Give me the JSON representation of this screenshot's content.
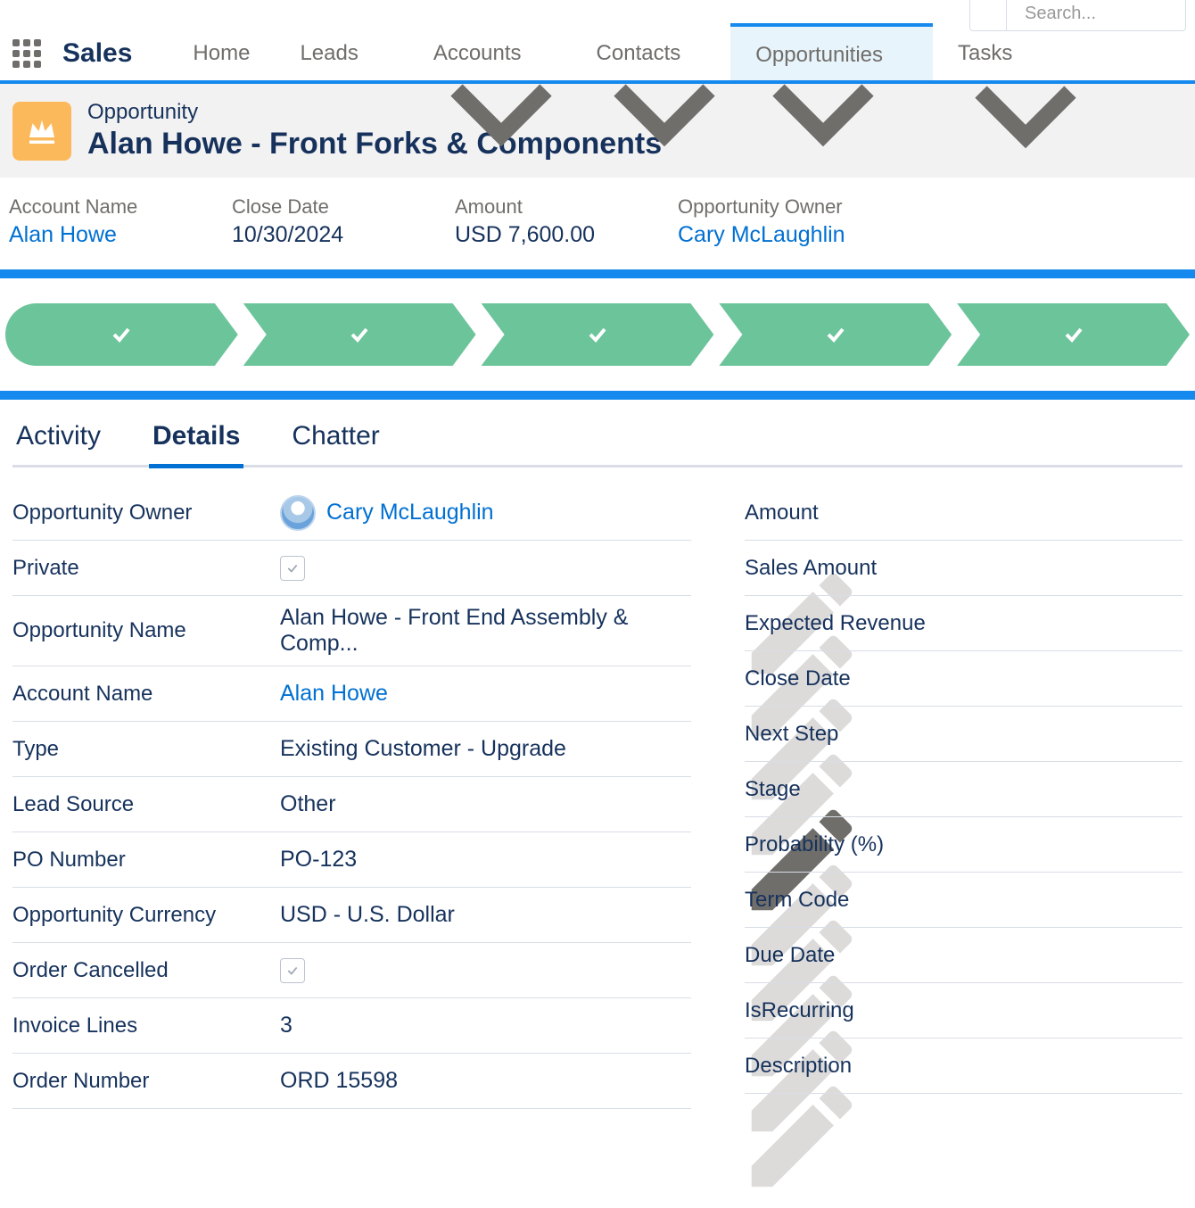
{
  "app_name": "Sales",
  "search": {
    "seg1": "",
    "placeholder": "Search..."
  },
  "nav": {
    "home": "Home",
    "leads": "Leads",
    "accounts": "Accounts",
    "contacts": "Contacts",
    "opportunities": "Opportunities",
    "tasks": "Tasks"
  },
  "record": {
    "object_label": "Opportunity",
    "title": "Alan Howe - Front Forks & Components"
  },
  "summary": {
    "account_label": "Account Name",
    "account_value": "Alan Howe",
    "close_label": "Close Date",
    "close_value": "10/30/2024",
    "amount_label": "Amount",
    "amount_value": "USD 7,600.00",
    "owner_label": "Opportunity Owner",
    "owner_value": "Cary McLaughlin"
  },
  "tabs": {
    "activity": "Activity",
    "details": "Details",
    "chatter": "Chatter"
  },
  "fields_left": {
    "owner": {
      "label": "Opportunity Owner",
      "value": "Cary McLaughlin"
    },
    "private": {
      "label": "Private"
    },
    "name": {
      "label": "Opportunity Name",
      "value": "Alan Howe - Front End Assembly & Comp..."
    },
    "account": {
      "label": "Account Name",
      "value": "Alan Howe"
    },
    "type": {
      "label": "Type",
      "value": "Existing Customer - Upgrade"
    },
    "leadsrc": {
      "label": "Lead Source",
      "value": "Other"
    },
    "po": {
      "label": "PO Number",
      "value": "PO-123"
    },
    "currency": {
      "label": "Opportunity Currency",
      "value": "USD - U.S. Dollar"
    },
    "cancelled": {
      "label": "Order Cancelled"
    },
    "invoice": {
      "label": "Invoice Lines",
      "value": "3"
    },
    "ordnum": {
      "label": "Order Number",
      "value": "ORD 15598"
    }
  },
  "fields_right": {
    "amount": "Amount",
    "sales_amount": "Sales Amount",
    "expected": "Expected Revenue",
    "close": "Close Date",
    "next": "Next Step",
    "stage": "Stage",
    "prob": "Probability (%)",
    "term": "Term Code",
    "due": "Due Date",
    "recur": "IsRecurring",
    "desc": "Description"
  }
}
